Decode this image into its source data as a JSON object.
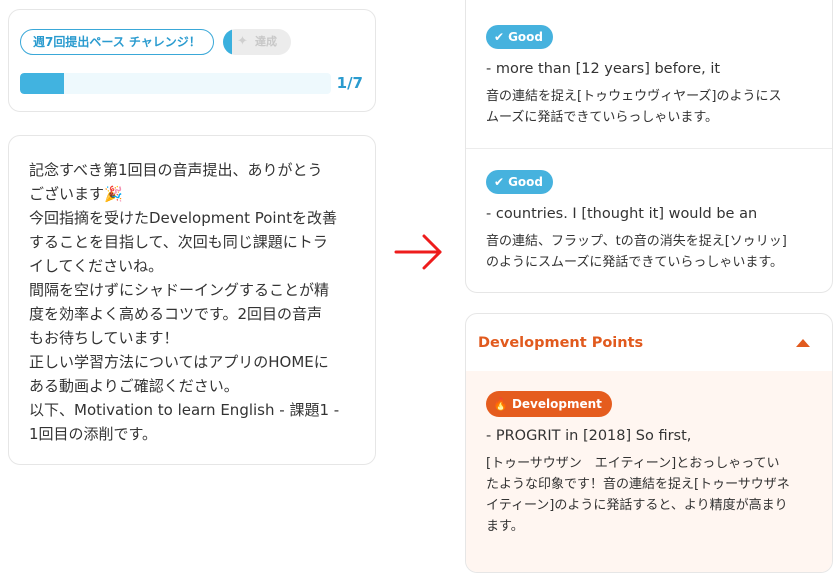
{
  "challenge": {
    "label": "週7回提出ペース チャレンジ！",
    "achieve_label": "達成",
    "progress_fraction": 0.14,
    "progress_text": "1/7",
    "accent_color": "#41b3e0"
  },
  "message": {
    "lines": [
      "記念すべき第1回目の音声提出、ありがとう",
      "ございます",
      "今回指摘を受けたDevelopment Pointを改善",
      "することを目指して、次回も同じ課題にトラ",
      "イしてくださいね。",
      "間隔を空けずにシャドーイングすることが精",
      "度を効率よく高めるコツです。2回目の音声",
      "もお待ちしています！",
      "正しい学習方法についてはアプリのHOMEに",
      "ある動画よりご確認ください。",
      "以下、Motivation to learn English - 課題1 -",
      "1回目の添削です。"
    ],
    "emoji_icon": "party-popper-icon"
  },
  "good_points": [
    {
      "badge": "Good",
      "phrase": "- more than [12 years] before, it",
      "comment_lines": [
        "音の連結を捉え[トゥウェウヴィヤーズ]のようにス",
        "ムーズに発話できていらっしゃいます。"
      ]
    },
    {
      "badge": "Good",
      "phrase": "- countries. I [thought it] would be an",
      "comment_lines": [
        "音の連結、フラップ、tの音の消失を捉え[ソゥリッ]",
        "のようにスムーズに発話できていらっしゃいます。"
      ]
    }
  ],
  "development": {
    "title": "Development Points",
    "accent_color": "#e15a1e",
    "items": [
      {
        "badge": "Development",
        "phrase": "- PROGRIT in [2018] So first,",
        "comment_lines": [
          "[トゥーサウザン　エイティーン]とおっしゃってい",
          "たような印象です！音の連結を捉え[トゥーサウザネ",
          "イティーン]のように発話すると、より精度が高まり",
          "ます。"
        ]
      }
    ]
  }
}
